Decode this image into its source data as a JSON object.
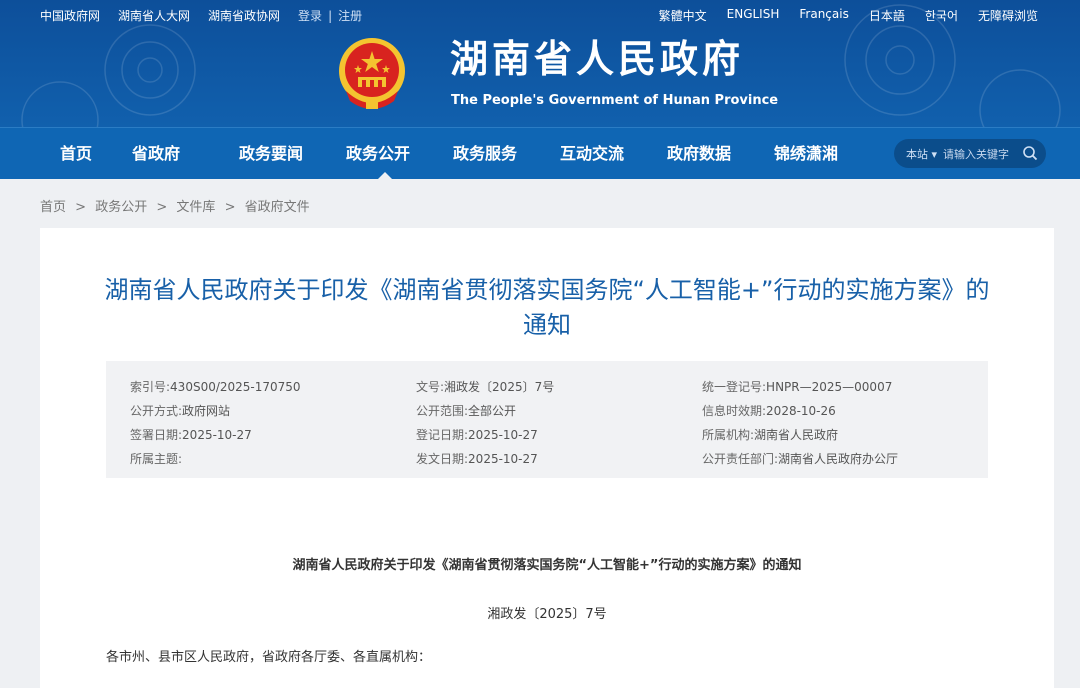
{
  "header": {
    "top_links": [
      "中国政府网",
      "湖南省人大网",
      "湖南省政协网"
    ],
    "login": "登录",
    "login_sep": "|",
    "register": "注册",
    "languages": [
      "繁體中文",
      "ENGLISH",
      "Français",
      "日本語",
      "한국어",
      "无障碍浏览"
    ],
    "site_title": "湖南省人民政府",
    "site_subtitle": "The People's Government of Hunan Province"
  },
  "nav": {
    "items": [
      "首页",
      "省政府",
      "政务要闻",
      "政务公开",
      "政务服务",
      "互动交流",
      "政府数据",
      "锦绣潇湘"
    ],
    "active_index": 3,
    "search_scope": "本站 ▾",
    "search_placeholder": "请输入关键字"
  },
  "breadcrumb": [
    "首页",
    "政务公开",
    "文件库",
    "省政府文件"
  ],
  "breadcrumb_sep": ">",
  "article": {
    "title": "湖南省人民政府关于印发《湖南省贯彻落实国务院“人工智能+”行动的实施方案》的通知",
    "meta": [
      [
        [
          "索引号:",
          "430S00/2025-170750"
        ],
        [
          "文号:",
          "湘政发〔2025〕7号"
        ],
        [
          "统一登记号:",
          "HNPR—2025—00007"
        ]
      ],
      [
        [
          "公开方式:",
          "政府网站"
        ],
        [
          "公开范围:",
          "全部公开"
        ],
        [
          "信息时效期:",
          "2028-10-26"
        ]
      ],
      [
        [
          "签署日期:",
          "2025-10-27"
        ],
        [
          "登记日期:",
          "2025-10-27"
        ],
        [
          "所属机构:",
          "湖南省人民政府"
        ]
      ],
      [
        [
          "所属主题:",
          ""
        ],
        [
          "发文日期:",
          "2025-10-27"
        ],
        [
          "公开责任部门:",
          "湖南省人民政府办公厅"
        ]
      ]
    ],
    "doc_title": "湖南省人民政府关于印发《湖南省贯彻落实国务院“人工智能+”行动的实施方案》的通知",
    "doc_number": "湘政发〔2025〕7号",
    "greeting": "各市州、县市区人民政府，省政府各厅委、各直属机构："
  },
  "colors": {
    "banner": "#0d4f9a",
    "nav": "#0f66b4",
    "title_blue": "#1860a8",
    "emblem_red": "#d8231f",
    "emblem_gold": "#f4c430"
  }
}
